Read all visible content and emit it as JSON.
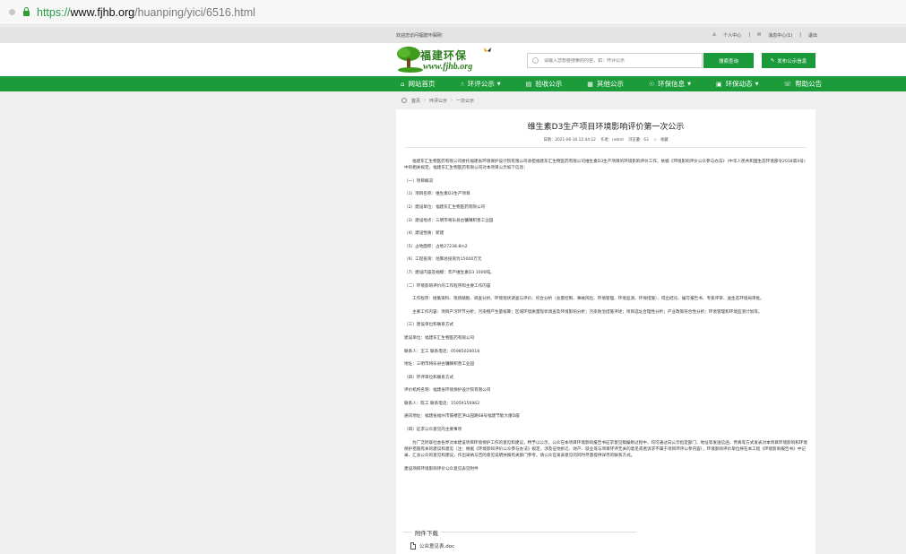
{
  "browser": {
    "url_scheme": "https://",
    "url_host": "www.fjhb.org",
    "url_path": "/huanping/yici/6516.html"
  },
  "topbar": {
    "welcome": "欢迎您访问福建环保网!",
    "personal_center": "个人中心",
    "message_center": "消息中心(1)",
    "logout": "退出"
  },
  "header": {
    "logo_zh": "福建环保",
    "logo_en": "www.fjhb.org",
    "search_placeholder": "请输入您想要搜索的内容，如：环评公示",
    "search_button": "搜索查询",
    "publish_button": "发布公示信息"
  },
  "nav": {
    "items": [
      {
        "label": "网站首页",
        "icon": "⌂",
        "caret": false
      },
      {
        "label": "环评公示",
        "icon": "☝",
        "caret": true
      },
      {
        "label": "验收公示",
        "icon": "▤",
        "caret": false
      },
      {
        "label": "其他公示",
        "icon": "▦",
        "caret": false
      },
      {
        "label": "环保信息",
        "icon": "☉",
        "caret": true
      },
      {
        "label": "环保动态",
        "icon": "▣",
        "caret": true
      },
      {
        "label": "帮助公告",
        "icon": "☏",
        "caret": false
      }
    ]
  },
  "breadcrumb": {
    "items": [
      "首页",
      "环评公示",
      "一次公示"
    ]
  },
  "article": {
    "title": "维生素D3生产项目环境影响评价第一次公示",
    "meta_date": "日期：2021-06-16 12:44:12",
    "meta_author": "作者：netrel",
    "meta_views": "浏览量：63",
    "meta_favorite": "收藏",
    "paragraphs": [
      {
        "indent": true,
        "text": "福建东汇生物医药有限公司委托福建省环境保护设计院有限公司承担福建东汇生物医药有限公司维生素D3生产项目的环境影响评价工作，依据《环境影响评价公众参与办法》（中华人民共和国生态环境部令2018第4号）中的相关规定，福建东汇生物医药有限公司对本项目公示如下信息："
      },
      {
        "indent": false,
        "text": "（一）项目概况"
      },
      {
        "indent": false,
        "text": "（1）项目名称：维生素D3生产项目"
      },
      {
        "indent": false,
        "text": "（2）建设单位：福建东汇生物医药有限公司"
      },
      {
        "indent": false,
        "text": "（3）建设地点：三明市将乐县古镛镇积善工业园"
      },
      {
        "indent": false,
        "text": "（4）建设性质：新建"
      },
      {
        "indent": false,
        "text": "（5）占地面积：占地27238.8m2"
      },
      {
        "indent": false,
        "text": "（6）工程投资：估算总投资为15000万元"
      },
      {
        "indent": false,
        "text": "（7）建设内容及规模：年产维生素D3 1000吨。"
      },
      {
        "indent": false,
        "text": "（二）环境影响评价的工作程序和主要工作内容"
      },
      {
        "indent": true,
        "text": "工作程序：搜集资料、现场踏勘、调查分析、环境现状调查与评价、综合分析（总量控制、事故风险、环境管理、环境监测、环保措施）、得出结论、编写报告书、专家评审、送生态环境局审批。"
      },
      {
        "indent": true,
        "text": "主要工作内容：项目产污环节分析；污染物产生量核算；区域环境质量现状调查及环境影响分析；污染防治措施评述；项目选址合理性分析；产业政策符合性分析；环境管理和环境监测计划等。"
      },
      {
        "indent": false,
        "text": "（三）建设单位和联系方式"
      },
      {
        "indent": false,
        "text": "建设单位：福建东汇生物医药有限公司"
      },
      {
        "indent": false,
        "text": "联系人：王工 联系电话：05985026018"
      },
      {
        "indent": false,
        "text": "地址：三明市将乐县古镛镇积善工业园"
      },
      {
        "indent": false,
        "text": "（四）环评单位和联系方式"
      },
      {
        "indent": false,
        "text": "评价机构名称：福建省环境保护设计院有限公司"
      },
      {
        "indent": false,
        "text": "联系人：陈工 联系电话：15059156962"
      },
      {
        "indent": false,
        "text": "通讯地址：福建省福州市鼓楼区洪山园路68号福建节能大厦D座"
      },
      {
        "indent": false,
        "text": "（四）征求公众意见的主要事项"
      },
      {
        "indent": true,
        "text": "为广泛听取社会各界对本建设项目环境保护工作的意见和建议，特予以公示。公众在本项目环境影响报告书征求意见稿编制过程中，均可通过向公示指定部门、地址等发送信函、传真等方式发表对本项目环境影响和环境保护措施有关的建议和意见（注：根据《环境影响评价公众参与办法》规定，涉及征地拆迁、财产、就业等与项目环评无关的意见或者诉求不属于项目环评公参内容），环境影响评价单位将在本工程《环境影响报告书》中记录、汇总公众的意见和建议，作出采纳与否的意见说明并报有关部门参考。请公众在发表意见的同时尽量提供详尽的联系方式。"
      },
      {
        "indent": false,
        "text": "建设项目环境影响评价公众意见表见附件"
      }
    ]
  },
  "attachment": {
    "legend": "附件下载",
    "file_name": "公众意见表.doc"
  }
}
